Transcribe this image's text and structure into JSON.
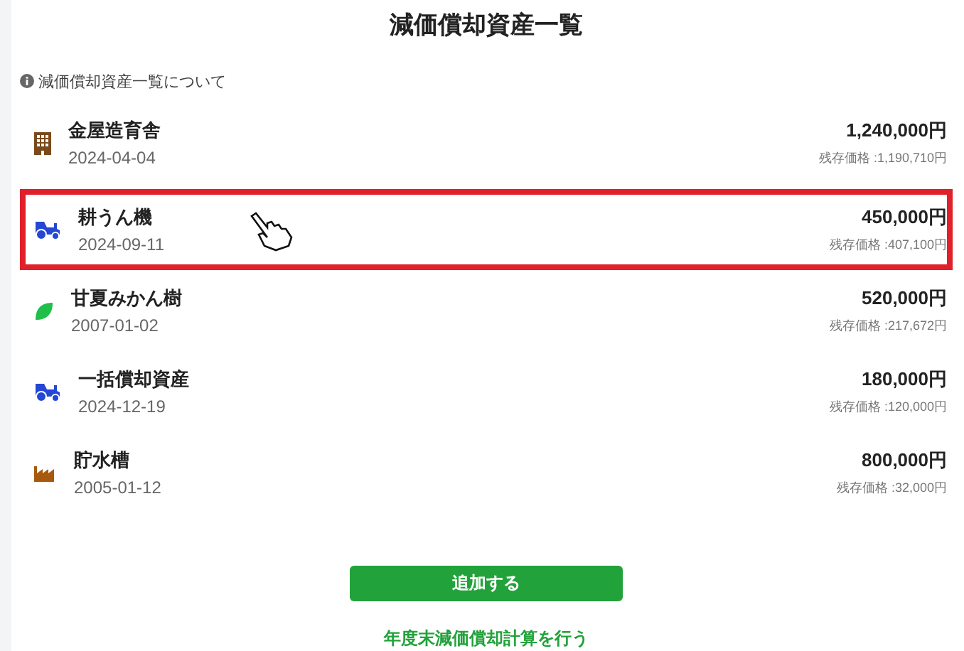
{
  "title": "減価償却資産一覧",
  "info": "減価償却資産一覧について",
  "assets": [
    {
      "kind": "building",
      "name": "金屋造育舎",
      "date": "2024-04-04",
      "amount": "1,240,000円",
      "residual": "残存価格 :1,190,710円",
      "selected": false
    },
    {
      "kind": "tractor",
      "name": "耕うん機",
      "date": "2024-09-11",
      "amount": "450,000円",
      "residual": "残存価格 :407,100円",
      "selected": true
    },
    {
      "kind": "leaf",
      "name": "甘夏みかん樹",
      "date": "2007-01-02",
      "amount": "520,000円",
      "residual": "残存価格 :217,672円",
      "selected": false
    },
    {
      "kind": "tractor",
      "name": "一括償却資産",
      "date": "2024-12-19",
      "amount": "180,000円",
      "residual": "残存価格 :120,000円",
      "selected": false
    },
    {
      "kind": "factory",
      "name": "貯水槽",
      "date": "2005-01-12",
      "amount": "800,000円",
      "residual": "残存価格 :32,000円",
      "selected": false
    }
  ],
  "add_button": "追加する",
  "year_end_link": "年度末減価償却計算を行う"
}
